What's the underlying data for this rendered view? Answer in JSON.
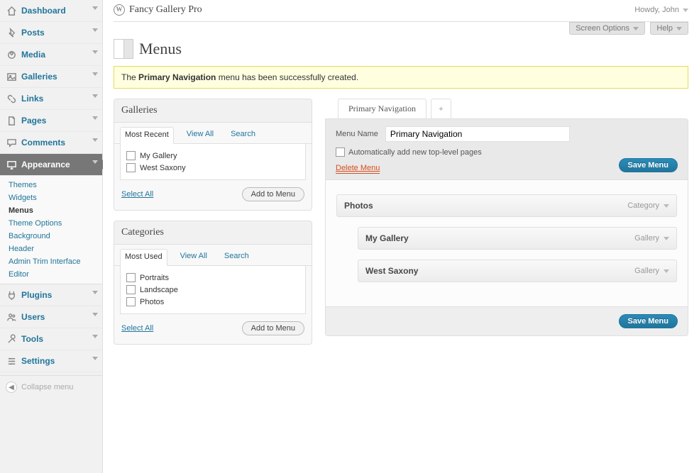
{
  "site_title": "Fancy Gallery Pro",
  "howdy": "Howdy, John",
  "screen_options_label": "Screen Options",
  "help_label": "Help",
  "page_title": "Menus",
  "notice": {
    "prefix": "The ",
    "strong": "Primary Navigation",
    "suffix": " menu has been successfully created."
  },
  "sidebar": {
    "items": [
      {
        "label": "Dashboard",
        "icon": "home"
      },
      {
        "label": "Posts",
        "icon": "pin"
      },
      {
        "label": "Media",
        "icon": "media"
      },
      {
        "label": "Galleries",
        "icon": "gallery"
      },
      {
        "label": "Links",
        "icon": "link"
      },
      {
        "label": "Pages",
        "icon": "page"
      },
      {
        "label": "Comments",
        "icon": "comment"
      },
      {
        "label": "Appearance",
        "icon": "appearance",
        "current": true,
        "submenu": [
          "Themes",
          "Widgets",
          "Menus",
          "Theme Options",
          "Background",
          "Header",
          "Admin Trim Interface",
          "Editor"
        ],
        "submenu_current": "Menus"
      },
      {
        "label": "Plugins",
        "icon": "plugin"
      },
      {
        "label": "Users",
        "icon": "users"
      },
      {
        "label": "Tools",
        "icon": "tools"
      },
      {
        "label": "Settings",
        "icon": "settings"
      }
    ],
    "collapse": "Collapse menu"
  },
  "galleries_box": {
    "title": "Galleries",
    "tabs": [
      "Most Recent",
      "View All",
      "Search"
    ],
    "active_tab": 0,
    "items": [
      "My Gallery",
      "West Saxony"
    ],
    "select_all": "Select All",
    "add_btn": "Add to Menu"
  },
  "categories_box": {
    "title": "Categories",
    "tabs": [
      "Most Used",
      "View All",
      "Search"
    ],
    "active_tab": 0,
    "items": [
      "Portraits",
      "Landscape",
      "Photos"
    ],
    "select_all": "Select All",
    "add_btn": "Add to Menu"
  },
  "nav_tabs": {
    "primary": "Primary Navigation",
    "add": "+"
  },
  "menu_panel": {
    "name_label": "Menu Name",
    "name_value": "Primary Navigation",
    "auto_label": "Automatically add new top-level pages",
    "delete_label": "Delete Menu",
    "save_label": "Save Menu",
    "items": [
      {
        "title": "Photos",
        "type": "Category",
        "depth": 0
      },
      {
        "title": "My Gallery",
        "type": "Gallery",
        "depth": 1
      },
      {
        "title": "West Saxony",
        "type": "Gallery",
        "depth": 1
      }
    ]
  }
}
